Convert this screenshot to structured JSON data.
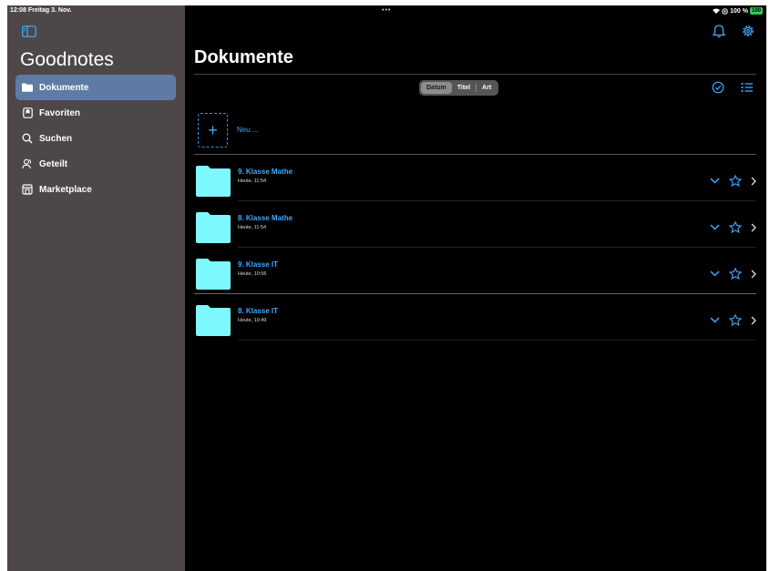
{
  "status_bar": {
    "time_date": "12:08  Freitag 3. Nov.",
    "dots": "•••",
    "battery_text": "100 %",
    "battery_level": "100"
  },
  "sidebar": {
    "app_title": "Goodnotes",
    "items": [
      {
        "label": "Dokumente",
        "icon": "folder-icon",
        "active": true
      },
      {
        "label": "Favoriten",
        "icon": "bookmark-icon",
        "active": false
      },
      {
        "label": "Suchen",
        "icon": "search-icon",
        "active": false
      },
      {
        "label": "Geteilt",
        "icon": "shared-people-icon",
        "active": false
      },
      {
        "label": "Marketplace",
        "icon": "marketplace-icon",
        "active": false
      }
    ]
  },
  "main": {
    "title": "Dokumente",
    "sort_tabs": [
      {
        "label": "Datum",
        "active": true
      },
      {
        "label": "Titel",
        "active": false
      },
      {
        "label": "Art",
        "active": false
      }
    ],
    "new_label": "Neu ...",
    "documents": [
      {
        "title": "9. Klasse Mathe",
        "date": "Heute, 11:54"
      },
      {
        "title": "8. Klasse Mathe",
        "date": "Heute, 11:54"
      },
      {
        "title": "9. Klasse IT",
        "date": "Heute, 10:56"
      },
      {
        "title": "8. Klasse IT",
        "date": "Heute, 10:49"
      }
    ]
  },
  "colors": {
    "accent": "#3fa9ff",
    "folder": "#7ef8ff",
    "sidebar_bg": "#4d4847",
    "active_item": "#5e7ba6"
  }
}
